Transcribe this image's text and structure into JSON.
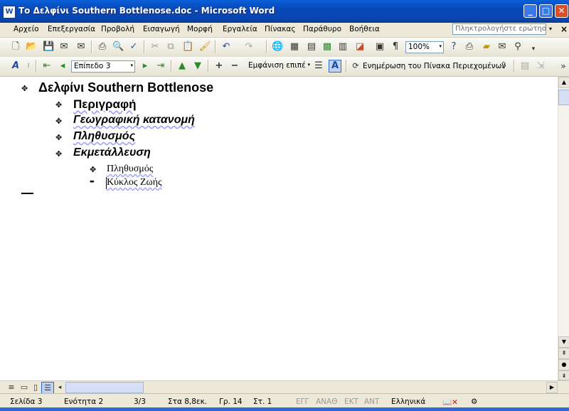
{
  "window": {
    "icon_label": "W",
    "title": "Το Δελφίνι Southern Bottlenose.doc - Microsoft Word",
    "min_label": "_",
    "max_label": "□",
    "close_label": "✕"
  },
  "menu": {
    "items": [
      "Αρχείο",
      "Επεξεργασία",
      "Προβολή",
      "Εισαγωγή",
      "Μορφή",
      "Εργαλεία",
      "Πίνακας",
      "Παράθυρο",
      "Βοήθεια"
    ],
    "ask_placeholder": "Πληκτρολογήστε ερώτηση",
    "ask_arrow": "▾",
    "doc_close": "×"
  },
  "standard_toolbar": {
    "zoom_value": "100%",
    "zoom_arrow": "▾",
    "overflow": "▾"
  },
  "outlining_toolbar": {
    "level_value": "Επίπεδο 3",
    "level_arrow": "▾",
    "show_level_value": "Εμφάνιση επιπέ",
    "show_level_arrow": "▾",
    "update_toc_label": "Ενημέρωση του Πίνακα Περιεχομένων",
    "overflow": "»"
  },
  "outline": [
    {
      "symbol": "✥",
      "text": "Δελφίνι Southern Bottlenose",
      "level": 1
    },
    {
      "symbol": "✥",
      "text": "Περιγραφή",
      "level": 2
    },
    {
      "symbol": "✥",
      "text": "Γεωγραφική κατανομή",
      "level": 2
    },
    {
      "symbol": "✥",
      "text": "Πληθυσμός",
      "level": 2
    },
    {
      "symbol": "✥",
      "text": "Εκμετάλλευση",
      "level": 2
    },
    {
      "symbol": "✥",
      "text": "Πληθυσμός",
      "level": 3
    },
    {
      "symbol": "▬",
      "text": "Κύκλος Ζωής",
      "level": 3
    }
  ],
  "status": {
    "page": "Σελίδα  3",
    "section": "Ενότητα  2",
    "pages": "3/3",
    "at": "Στα 8,8εκ.",
    "line": "Γρ. 14",
    "column": "Στ. 1",
    "rec": "ΕΓΓ",
    "trk": "ΑΝΑΘ",
    "ext": "ΕΚΤ",
    "ovr": "ΑΝΤ",
    "language": "Ελληνικά"
  },
  "colors": {
    "titlebar": "#0a5fd8",
    "chrome": "#ece9d8",
    "document_bg": "#ffffff"
  }
}
